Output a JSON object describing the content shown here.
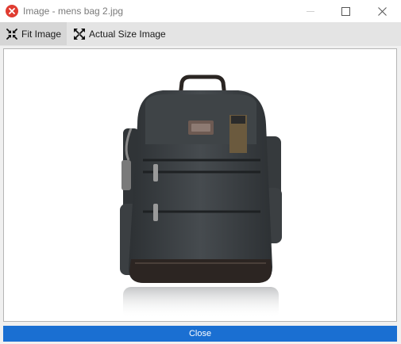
{
  "window": {
    "title": "Image - mens bag 2.jpg",
    "icon": "error-x-icon"
  },
  "toolbar": {
    "fit_label": "Fit Image",
    "actual_label": "Actual Size Image",
    "fit_icon": "shrink-arrows-icon",
    "actual_icon": "expand-arrows-icon"
  },
  "viewer": {
    "image_subject": "backpack-image"
  },
  "footer": {
    "close_label": "Close"
  },
  "colors": {
    "accent": "#1a6fd2",
    "app_icon_red": "#e03c31",
    "toolbar_bg": "#e4e4e4"
  }
}
